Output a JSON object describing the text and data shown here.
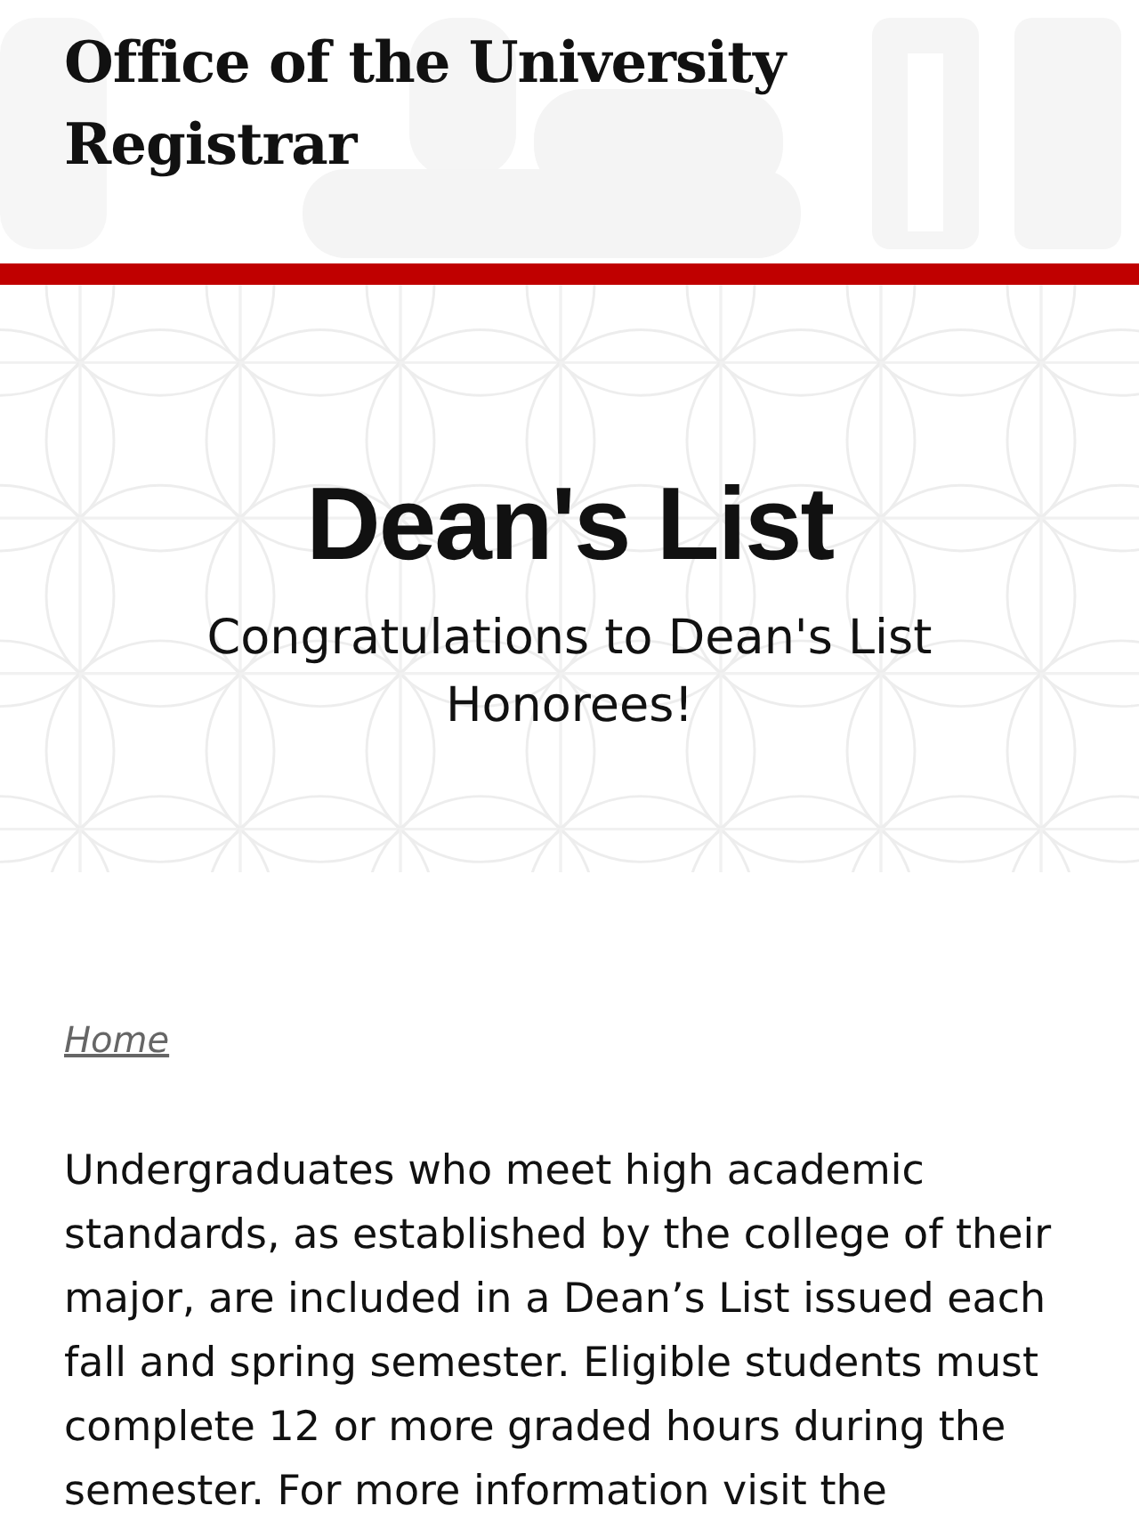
{
  "header": {
    "title": "Office of the University Registrar"
  },
  "hero": {
    "title": "Dean's List",
    "subtitle": "Congratulations to Dean's List Honorees!"
  },
  "breadcrumb": {
    "label": "Home"
  },
  "body": {
    "paragraph": "Undergraduates who meet high academic standards, as established by the college of their major, are included in a Dean’s List issued each fall and spring semester. Eligible students must complete 12 or more graded hours during the semester. For more information visit the"
  }
}
